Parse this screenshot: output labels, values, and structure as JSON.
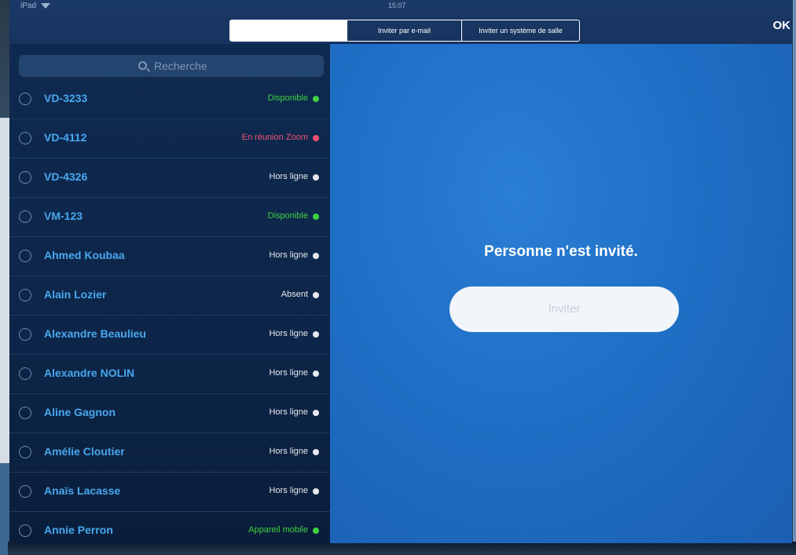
{
  "status_bar": {
    "device": "iPad",
    "time": "15:07"
  },
  "tabs": [
    {
      "label": ""
    },
    {
      "label": "Inviter par e-mail"
    },
    {
      "label": "Inviter un système de salle"
    }
  ],
  "ok_label": "OK",
  "search": {
    "placeholder": "Recherche"
  },
  "contacts": [
    {
      "name": "VD-3233",
      "status": "Disponible",
      "status_color": "#3fd13f"
    },
    {
      "name": "VD-4112",
      "status": "En réunion Zoom",
      "status_color": "#f0506e"
    },
    {
      "name": "VD-4326",
      "status": "Hors ligne",
      "status_color": "#e6e9ee"
    },
    {
      "name": "VM-123",
      "status": "Disponible",
      "status_color": "#3fd13f"
    },
    {
      "name": "Ahmed Koubaa",
      "status": "Hors ligne",
      "status_color": "#e6e9ee"
    },
    {
      "name": "Alain Lozier",
      "status": "Absent",
      "status_color": "#e6e9ee"
    },
    {
      "name": "Alexandre Beaulieu",
      "status": "Hors ligne",
      "status_color": "#e6e9ee"
    },
    {
      "name": "Alexandre NOLIN",
      "status": "Hors ligne",
      "status_color": "#e6e9ee"
    },
    {
      "name": "Aline Gagnon",
      "status": "Hors ligne",
      "status_color": "#e6e9ee"
    },
    {
      "name": "Amélie Cloutier",
      "status": "Hors ligne",
      "status_color": "#e6e9ee"
    },
    {
      "name": "Anaïs Lacasse",
      "status": "Hors ligne",
      "status_color": "#e6e9ee"
    },
    {
      "name": "Annie Perron",
      "status": "Appareil mobile",
      "status_color": "#3fd13f"
    }
  ],
  "main": {
    "empty_message": "Personne n'est invité.",
    "invite_label": "Inviter"
  },
  "colors": {
    "accent": "#48a8ee",
    "background": "#1f6fc6"
  }
}
